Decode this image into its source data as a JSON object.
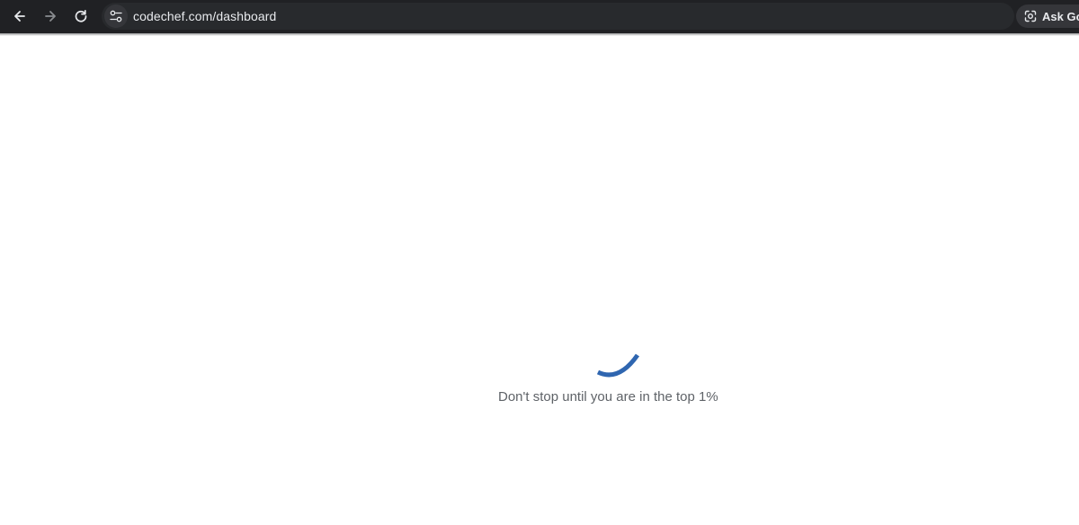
{
  "browser": {
    "url": "codechef.com/dashboard",
    "ask_google_label": "Ask Goo",
    "icons": {
      "back": "arrow-left-icon",
      "forward": "arrow-right-icon",
      "reload": "reload-icon",
      "site_info": "tune-icon",
      "ask_google": "google-lens-icon"
    }
  },
  "page": {
    "loading_message": "Don't stop until you are in the top 1%",
    "spinner_color": "#2f66b0"
  }
}
